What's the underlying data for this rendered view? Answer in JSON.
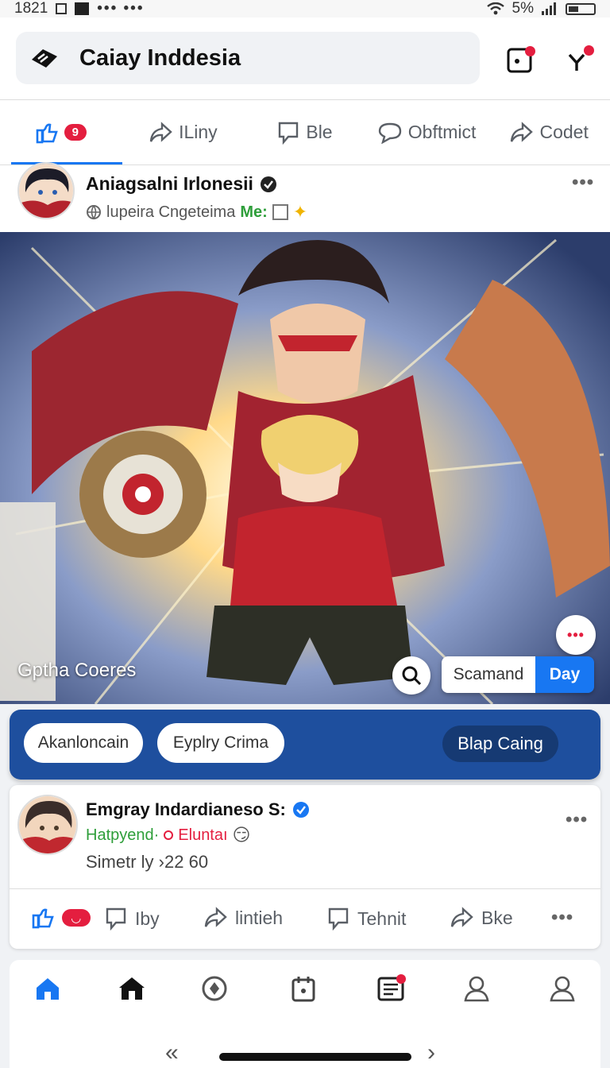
{
  "status_bar": {
    "time": "1821",
    "signal_text": "5%"
  },
  "header": {
    "title": "Caiay Inddesia"
  },
  "tabs": [
    {
      "label": "",
      "count": "9",
      "icon": "like-icon",
      "active": true
    },
    {
      "label": "ILiny",
      "icon": "share-icon"
    },
    {
      "label": "Ble",
      "icon": "comment-icon"
    },
    {
      "label": "Obftmict",
      "icon": "chat-icon"
    },
    {
      "label": "Codet",
      "icon": "share-icon"
    }
  ],
  "post1": {
    "author": "Aniagsalni Irlonesii",
    "meta_left": "lupeira Cngeteima",
    "meta_highlight": "Me:",
    "media_caption": "Gptha Coeres",
    "toggle_off": "Scamand",
    "toggle_on": "Day"
  },
  "action_banner": {
    "chip1": "Akanloncain",
    "chip2": "Eyplry Crima",
    "chip3": "Blap Caing"
  },
  "post2": {
    "author": "Emgray Indardianeso S:",
    "meta_green": "Hatpyend·",
    "meta_red": "Eluntaı",
    "subtext": "Simetr ly ›22  60",
    "reactions": [
      {
        "label": "",
        "icon": "like-icon"
      },
      {
        "label": "Iby",
        "icon": "comment-icon"
      },
      {
        "label": "lintieh",
        "icon": "share-icon"
      },
      {
        "label": "Tehnit",
        "icon": "chat-icon"
      },
      {
        "label": "Bke",
        "icon": "share-icon"
      }
    ]
  },
  "colors": {
    "accent": "#1877f2",
    "alert": "#e41e3f",
    "banner": "#1e4f9e"
  }
}
